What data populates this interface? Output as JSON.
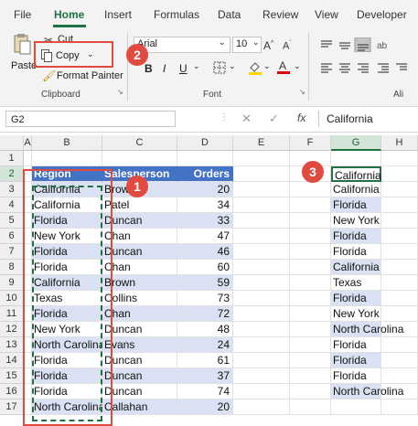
{
  "ribbon": {
    "tabs": [
      "File",
      "Home",
      "Insert",
      "Formulas",
      "Data",
      "Review",
      "View",
      "Developer"
    ],
    "active_tab": "Home",
    "clipboard": {
      "paste_label": "Paste",
      "cut_label": "Cut",
      "copy_label": "Copy",
      "format_painter_label": "Format Painter",
      "group_label": "Clipboard"
    },
    "font": {
      "font_name": "Arial",
      "font_size": "10",
      "bold": "B",
      "italic": "I",
      "underline": "U",
      "group_label": "Font"
    },
    "alignment": {
      "group_label": "Ali"
    }
  },
  "formula_bar": {
    "name_box": "G2",
    "fx": "fx",
    "value": "California"
  },
  "columns": [
    "A",
    "B",
    "C",
    "D",
    "E",
    "F",
    "G",
    "H"
  ],
  "rows": [
    "1",
    "2",
    "3",
    "4",
    "5",
    "6",
    "7",
    "8",
    "9",
    "10",
    "11",
    "12",
    "13",
    "14",
    "15",
    "16",
    "17"
  ],
  "table": {
    "headers": [
      "Region",
      "Salesperson",
      "Orders"
    ],
    "rows": [
      [
        "California",
        "Brown",
        "20"
      ],
      [
        "California",
        "Patel",
        "34"
      ],
      [
        "Florida",
        "Duncan",
        "33"
      ],
      [
        "New York",
        "Chan",
        "47"
      ],
      [
        "Florida",
        "Duncan",
        "46"
      ],
      [
        "Florida",
        "Chan",
        "60"
      ],
      [
        "California",
        "Brown",
        "59"
      ],
      [
        "Texas",
        "Collins",
        "73"
      ],
      [
        "Florida",
        "Chan",
        "72"
      ],
      [
        "New York",
        "Duncan",
        "48"
      ],
      [
        "North Carolina",
        "Evans",
        "24"
      ],
      [
        "Florida",
        "Duncan",
        "61"
      ],
      [
        "Florida",
        "Duncan",
        "37"
      ],
      [
        "Florida",
        "Duncan",
        "74"
      ],
      [
        "North Carolina",
        "Callahan",
        "20"
      ]
    ]
  },
  "pasted_g": [
    "California",
    "California",
    "Florida",
    "New York",
    "Florida",
    "Florida",
    "California",
    "Texas",
    "Florida",
    "New York",
    "North Carolina",
    "Florida",
    "Florida",
    "Florida",
    "North Carolina"
  ],
  "badges": [
    "1",
    "2",
    "3"
  ],
  "colors": {
    "excel_green": "#217346",
    "header_blue": "#4472c4",
    "band_blue": "#d9e1f2",
    "annotation_red": "#e04a3f"
  }
}
